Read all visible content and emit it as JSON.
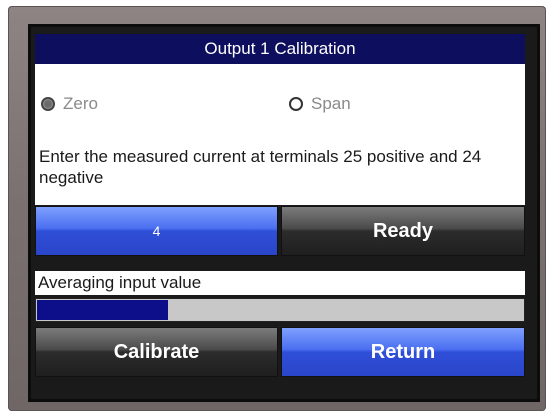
{
  "title": "Output 1 Calibration",
  "mode": {
    "zero_label": "Zero",
    "span_label": "Span",
    "selected": "Zero"
  },
  "instruction": "Enter the measured current at terminals 25 positive and 24 negative",
  "measured_value": "4",
  "ready_label": "Ready",
  "status_text": "Averaging input value",
  "progress_fraction": 0.27,
  "buttons": {
    "calibrate_label": "Calibrate",
    "return_label": "Return"
  },
  "colors": {
    "title_bg": "#0d0f5e",
    "progress_fill": "#0d0f8a",
    "blue_button": "#2f4fd8",
    "dark_button": "#2c2c2c"
  },
  "icons": {
    "zero_radio": "radio-checked-icon",
    "span_radio": "radio-unchecked-icon"
  }
}
